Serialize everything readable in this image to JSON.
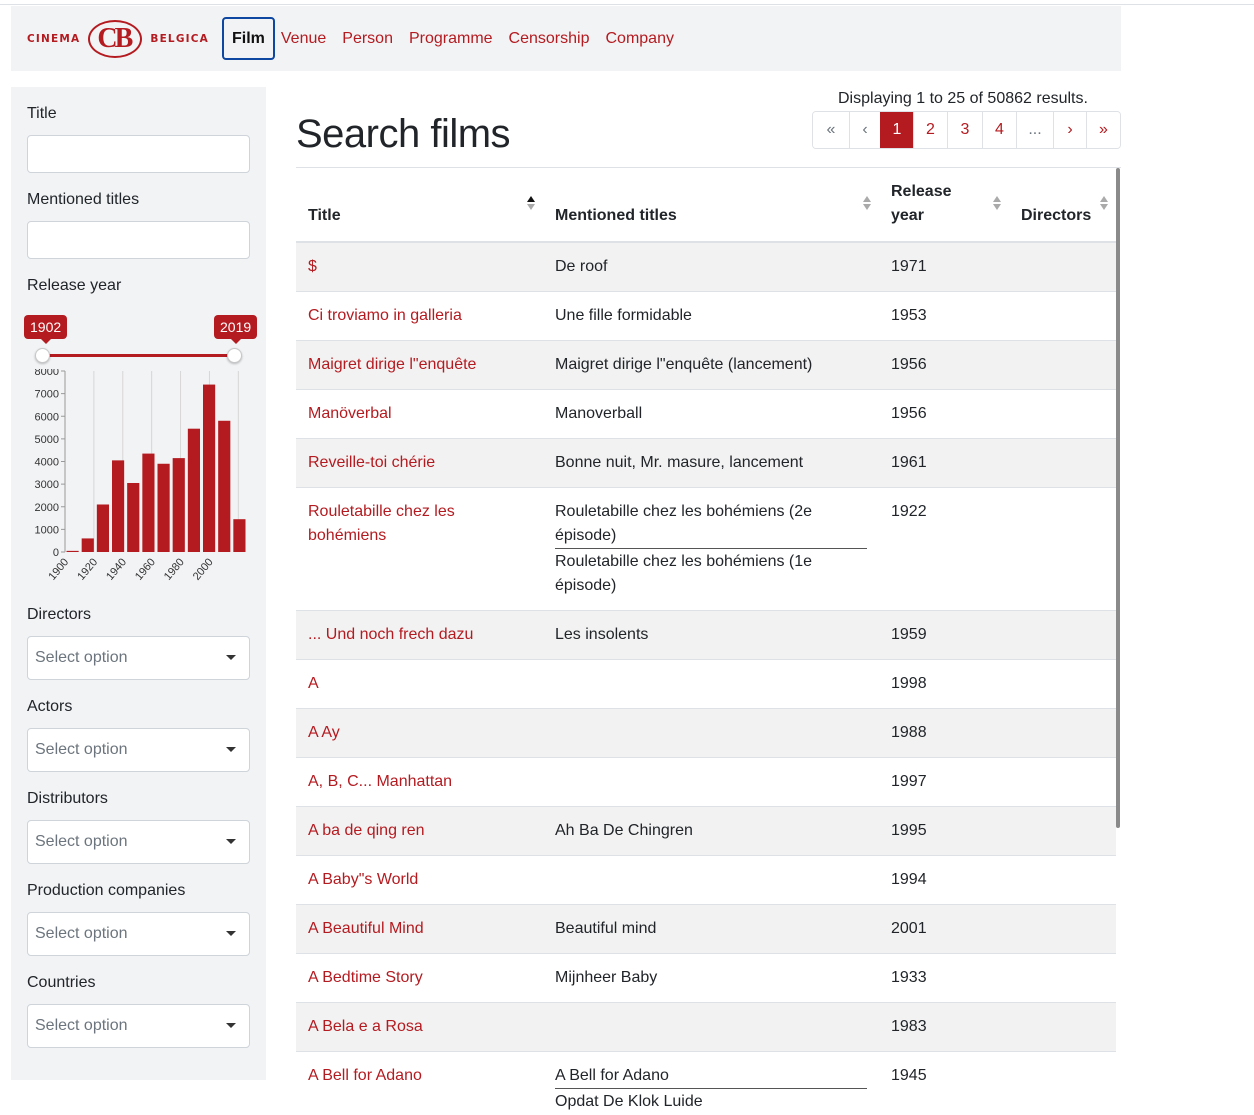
{
  "brand": {
    "left": "CINEMA",
    "badge": "CB",
    "right": "BELGICA",
    "color": "#b41b20"
  },
  "nav": [
    {
      "label": "Film",
      "active": true
    },
    {
      "label": "Venue"
    },
    {
      "label": "Person"
    },
    {
      "label": "Programme"
    },
    {
      "label": "Censorship"
    },
    {
      "label": "Company"
    }
  ],
  "filters": {
    "title_label": "Title",
    "title_value": "",
    "mentioned_label": "Mentioned titles",
    "mentioned_value": "",
    "release_label": "Release year",
    "year_min": "1902",
    "year_max": "2019",
    "histogram": {
      "y_ticks": [
        "8000",
        "7000",
        "6000",
        "5000",
        "4000",
        "3000",
        "2000",
        "1000",
        "0"
      ],
      "x_ticks": [
        "1900",
        "1920",
        "1940",
        "1960",
        "1980",
        "2000"
      ],
      "ymax": 8000,
      "values": [
        50,
        600,
        2100,
        4050,
        3050,
        4350,
        3900,
        4150,
        5450,
        7400,
        5800,
        1450
      ]
    },
    "directors_label": "Directors",
    "actors_label": "Actors",
    "distributors_label": "Distributors",
    "production_label": "Production companies",
    "countries_label": "Countries",
    "select_placeholder": "Select option"
  },
  "main": {
    "title": "Search films",
    "count_text": "Displaying 1 to 25 of 50862 results.",
    "pagination": [
      "«",
      "‹",
      "1",
      "2",
      "3",
      "4",
      "...",
      "›",
      "»"
    ],
    "columns": [
      "Title",
      "Mentioned titles",
      "Release year",
      "Directors"
    ]
  },
  "rows": [
    {
      "title": "$",
      "mentioned": [
        "De roof"
      ],
      "year": "1971",
      "directors": ""
    },
    {
      "title": "Ci troviamo in galleria",
      "mentioned": [
        "Une fille formidable"
      ],
      "year": "1953",
      "directors": ""
    },
    {
      "title": "Maigret dirige l\"enquête",
      "mentioned": [
        "Maigret dirige l\"enquête (lancement)"
      ],
      "year": "1956",
      "directors": ""
    },
    {
      "title": "Manöverbal",
      "mentioned": [
        "Manoverball"
      ],
      "year": "1956",
      "directors": ""
    },
    {
      "title": "Reveille-toi chérie",
      "mentioned": [
        "Bonne nuit, Mr. masure, lancement"
      ],
      "year": "1961",
      "directors": ""
    },
    {
      "title": "Rouletabille chez les bohémiens",
      "mentioned": [
        "Rouletabille chez les bohémiens (2e épisode)",
        "Rouletabille chez les bohémiens (1e épisode)"
      ],
      "year": "1922",
      "directors": ""
    },
    {
      "title": "... Und noch frech dazu",
      "mentioned": [
        "Les insolents"
      ],
      "year": "1959",
      "directors": ""
    },
    {
      "title": "A",
      "mentioned": [],
      "year": "1998",
      "directors": ""
    },
    {
      "title": "A Ay",
      "mentioned": [],
      "year": "1988",
      "directors": ""
    },
    {
      "title": "A, B, C... Manhattan",
      "mentioned": [],
      "year": "1997",
      "directors": ""
    },
    {
      "title": "A ba de qing ren",
      "mentioned": [
        "Ah Ba De Chingren"
      ],
      "year": "1995",
      "directors": ""
    },
    {
      "title": "A Baby\"s World",
      "mentioned": [],
      "year": "1994",
      "directors": ""
    },
    {
      "title": "A Beautiful Mind",
      "mentioned": [
        "Beautiful mind"
      ],
      "year": "2001",
      "directors": ""
    },
    {
      "title": "A Bedtime Story",
      "mentioned": [
        "Mijnheer Baby"
      ],
      "year": "1933",
      "directors": ""
    },
    {
      "title": "A Bela e a Rosa",
      "mentioned": [],
      "year": "1983",
      "directors": ""
    },
    {
      "title": "A Bell for Adano",
      "mentioned": [
        "A Bell for Adano",
        "Opdat De Klok Luide"
      ],
      "year": "1945",
      "directors": ""
    }
  ]
}
